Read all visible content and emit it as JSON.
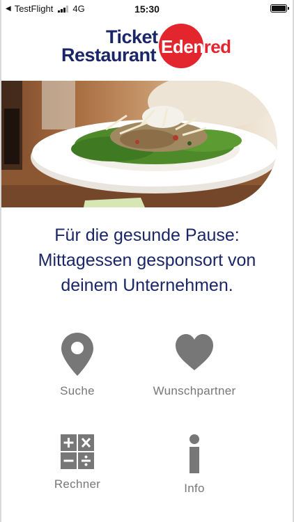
{
  "status_bar": {
    "back_app": "TestFlight",
    "network": "4G",
    "time": "15:30"
  },
  "logo": {
    "line1": "Ticket",
    "line2": "Restaurant",
    "brand_part1": "Ede",
    "brand_part2": "n",
    "brand_part3": "red"
  },
  "hero": {
    "image_subject": "salad-plate"
  },
  "tagline": {
    "line1": "Für die gesunde Pause:",
    "line2": "Mittagessen gesponsort von",
    "line3": "deinem Unternehmen."
  },
  "menu": {
    "items": [
      {
        "label": "Suche",
        "icon": "location-pin-icon"
      },
      {
        "label": "Wunschpartner",
        "icon": "heart-icon"
      },
      {
        "label": "Rechner",
        "icon": "calculator-icon"
      },
      {
        "label": "Info",
        "icon": "info-icon"
      }
    ]
  },
  "colors": {
    "brand_navy": "#1a2667",
    "brand_red": "#e3262e",
    "icon_grey": "#777777",
    "label_grey": "#777777"
  }
}
